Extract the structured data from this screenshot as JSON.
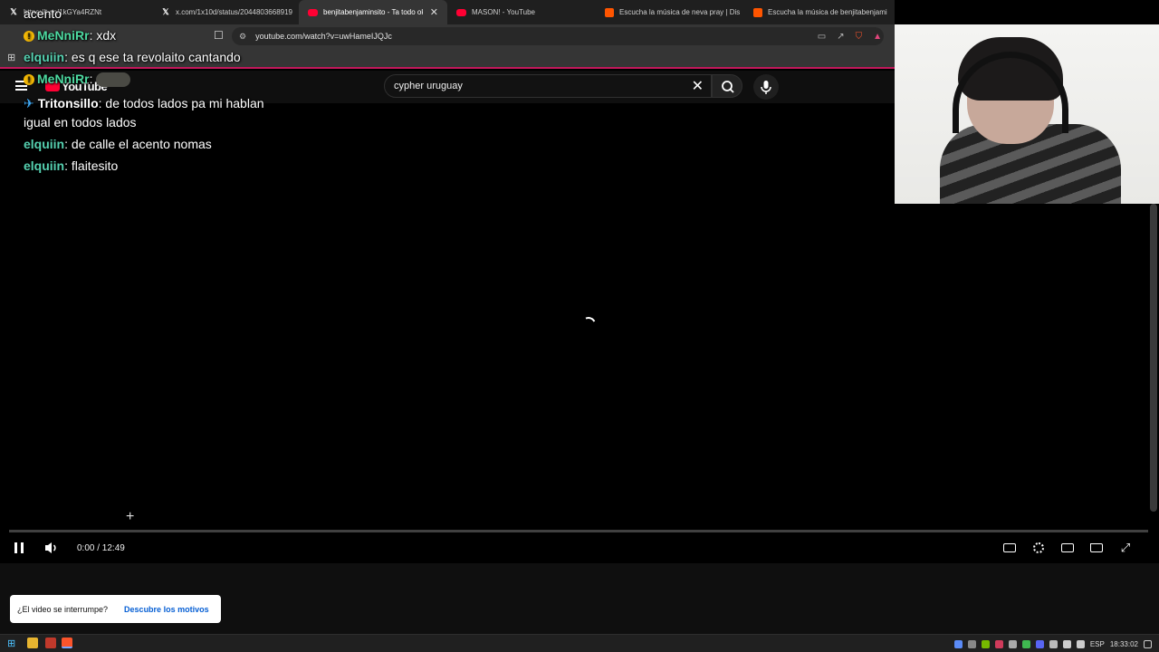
{
  "browser": {
    "tabs": [
      {
        "label": "https://t.co/1kGYa4RZNt",
        "icon": "x-logo-icon",
        "active": false
      },
      {
        "label": "x.com/1x10d/status/2044803668919",
        "icon": "x-logo-icon",
        "active": false
      },
      {
        "label": "benjitabenjaminsito - Ta todo ok",
        "icon": "youtube-favicon-icon",
        "active": true
      },
      {
        "label": "MASON! - YouTube",
        "icon": "youtube-favicon-icon",
        "active": false
      },
      {
        "label": "Escucha la música de neva pray | Dis",
        "icon": "soundcloud-favicon-icon",
        "active": false
      },
      {
        "label": "Escucha la música de benjitabenjami",
        "icon": "soundcloud-favicon-icon",
        "active": false
      }
    ],
    "url": "youtube.com/watch?v=uwHameIJQJc"
  },
  "youtube": {
    "logo": "YouTube",
    "search_value": "cypher uruguay"
  },
  "chat": {
    "lines": [
      {
        "user": "",
        "text": "acento"
      },
      {
        "user": "MeNniRr",
        "text": ": xdx"
      },
      {
        "user": "elquiin",
        "text": ": es q ese ta revolaito cantando"
      },
      {
        "user": "MeNniRr",
        "text": ":"
      },
      {
        "user": "Tritonsillo",
        "text": ": de todos lados pa mi hablan"
      },
      {
        "user": "",
        "text": "igual en todos lados"
      },
      {
        "user": "elquiin",
        "text": ": de calle el acento nomas"
      },
      {
        "user": "elquiin",
        "text": ": flaitesito"
      }
    ]
  },
  "player": {
    "time": "0:00 / 12:49",
    "progress": 0.0
  },
  "toast": {
    "message": "¿El video se interrumpe?",
    "link": "Descubre los motivos"
  },
  "taskbar": {
    "lang": "ESP",
    "clock": "18:33:02"
  },
  "colors": {
    "youtube_red": "#ff0033",
    "chat_user_green": "#4dd9a0",
    "link_blue": "#065fd4",
    "bookmark_accent": "#c2185b"
  }
}
